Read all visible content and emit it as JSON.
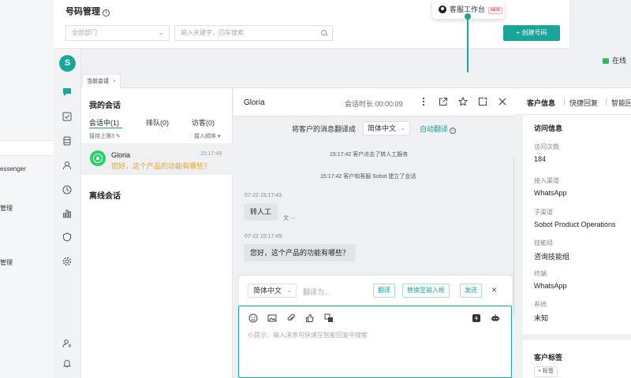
{
  "background": {
    "sidebar_items": [
      "essenger",
      "管理",
      "管理"
    ],
    "title": "号码管理",
    "department_placeholder": "全部部门",
    "search_placeholder": "输入关键字，回车搜索",
    "create_button": "+ 创建号码",
    "online_status": "在线"
  },
  "popover": {
    "label": "客服工作台",
    "badge": "NEW"
  },
  "app": {
    "logo": "S",
    "current_tab": "当前会话",
    "tab_close": "×"
  },
  "session_list": {
    "title": "我的会话",
    "tabs": [
      "会话中(1)",
      "排队(0)",
      "访客(0)"
    ],
    "queue_limit": "接待上限3 ✎",
    "sort": "接入顺序 ▾",
    "items": [
      {
        "name": "Gloria",
        "time": "15:17:49",
        "preview": "您好，这个产品的功能有哪些？"
      }
    ],
    "offline_title": "离线会话"
  },
  "chat": {
    "name": "Gloria",
    "duration": "会话时长 00:00:09",
    "translate_label": "将客户的消息翻译成",
    "translate_lang": "简体中文",
    "auto_translate": "自动翻译",
    "system_messages": [
      "15:17:42 客户点击了转人工服务",
      "15:17:42 客户和客服 Sobot 建立了会话"
    ],
    "messages": [
      {
        "time": "07-22 15:17:43",
        "text": "转人工",
        "extra": "文 ···"
      },
      {
        "time": "07-22 15:17:49",
        "text": "您好，这个产品的功能有哪些？"
      }
    ]
  },
  "translate_toolbar": {
    "language": "简体中文",
    "placeholder": "翻译为...",
    "translate": "翻译",
    "replace": "替换至输入框",
    "send": "发送",
    "close": "×"
  },
  "composer": {
    "hint": "小提示：输入消息可快速在智能回复中搜索"
  },
  "info_panel": {
    "tabs": [
      "客户信息",
      "快捷回复",
      "智能回"
    ],
    "section_title": "访问信息",
    "fields": [
      {
        "label": "访问次数",
        "value": "184"
      },
      {
        "label": "接入渠道",
        "value": "WhatsApp"
      },
      {
        "label": "子渠道",
        "value": "Sobot Product Operations"
      },
      {
        "label": "技能组",
        "value": "咨询技能组"
      },
      {
        "label": "终端",
        "value": "WhatsApp"
      },
      {
        "label": "系统",
        "value": "未知"
      }
    ],
    "tag_title": "客户标签",
    "tag_button": "+ 标签"
  }
}
